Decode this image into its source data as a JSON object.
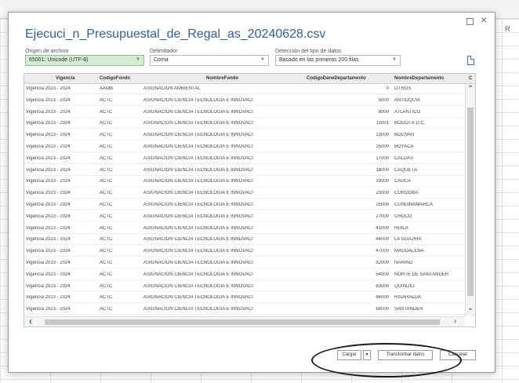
{
  "background": {
    "column_label": "R"
  },
  "dialog": {
    "title": "Ejecuci_n_Presupuestal_de_Regal_as_20240628.csv",
    "window_controls": {
      "maximize_icon": "maximize-icon",
      "close_glyph": "×"
    },
    "options": {
      "origin": {
        "label": "Origen de archivo",
        "value": "65001: Unicode (UTF-8)"
      },
      "delimiter": {
        "label": "Delimitador",
        "value": "Coma"
      },
      "detection": {
        "label": "Detección del tipo de datos",
        "value": "Basado en las primeras 200 filas"
      }
    },
    "table": {
      "columns": [
        "Vigencia",
        "CodigoFondo",
        "NombreFondo",
        "CodigoDaneDepartamento",
        "NombreDepartamento",
        "C"
      ],
      "rows": [
        [
          "Vigencia 2023 - 2024",
          "AAMB",
          "ASIGNACIÓN AMBIENTAL",
          "0",
          "OTROS"
        ],
        [
          "Vigencia 2023 - 2024",
          "ACTC",
          "ASIGNACION CIENCIA TECNOLOGIA E INNOVACION CO...",
          "5000",
          "ANTIOQUIA"
        ],
        [
          "Vigencia 2023 - 2024",
          "ACTC",
          "ASIGNACION CIENCIA TECNOLOGIA E INNOVACION CO...",
          "8000",
          "ATLÁNTICO"
        ],
        [
          "Vigencia 2023 - 2024",
          "ACTC",
          "ASIGNACION CIENCIA TECNOLOGIA E INNOVACION CO...",
          "11001",
          "BOGOTÁ D.C."
        ],
        [
          "Vigencia 2023 - 2024",
          "ACTC",
          "ASIGNACION CIENCIA TECNOLOGIA E INNOVACION CO...",
          "13000",
          "BOLÍVAR"
        ],
        [
          "Vigencia 2023 - 2024",
          "ACTC",
          "ASIGNACION CIENCIA TECNOLOGIA E INNOVACION CO...",
          "15000",
          "BOYACÁ"
        ],
        [
          "Vigencia 2023 - 2024",
          "ACTC",
          "ASIGNACION CIENCIA TECNOLOGIA E INNOVACION CO...",
          "17000",
          "CALDAS"
        ],
        [
          "Vigencia 2023 - 2024",
          "ACTC",
          "ASIGNACION CIENCIA TECNOLOGIA E INNOVACION CO...",
          "18000",
          "CAQUETÁ"
        ],
        [
          "Vigencia 2023 - 2024",
          "ACTC",
          "ASIGNACION CIENCIA TECNOLOGIA E INNOVACION CO...",
          "19000",
          "CAUCA"
        ],
        [
          "Vigencia 2023 - 2024",
          "ACTC",
          "ASIGNACION CIENCIA TECNOLOGIA E INNOVACION CO...",
          "23000",
          "CÓRDOBA"
        ],
        [
          "Vigencia 2023 - 2024",
          "ACTC",
          "ASIGNACION CIENCIA TECNOLOGIA E INNOVACION CO...",
          "25000",
          "CUNDINAMARCA"
        ],
        [
          "Vigencia 2023 - 2024",
          "ACTC",
          "ASIGNACION CIENCIA TECNOLOGIA E INNOVACION CO...",
          "27000",
          "CHOCÓ"
        ],
        [
          "Vigencia 2023 - 2024",
          "ACTC",
          "ASIGNACION CIENCIA TECNOLOGIA E INNOVACION CO...",
          "41000",
          "HUILA"
        ],
        [
          "Vigencia 2023 - 2024",
          "ACTC",
          "ASIGNACION CIENCIA TECNOLOGIA E INNOVACION CO...",
          "44000",
          "LA GUAJIRA"
        ],
        [
          "Vigencia 2023 - 2024",
          "ACTC",
          "ASIGNACION CIENCIA TECNOLOGIA E INNOVACION CO...",
          "47000",
          "MAGDALENA"
        ],
        [
          "Vigencia 2023 - 2024",
          "ACTC",
          "ASIGNACION CIENCIA TECNOLOGIA E INNOVACION CO...",
          "52000",
          "NARIÑO"
        ],
        [
          "Vigencia 2023 - 2024",
          "ACTC",
          "ASIGNACION CIENCIA TECNOLOGIA E INNOVACION CO...",
          "54000",
          "NORTE DE SANTANDER"
        ],
        [
          "Vigencia 2023 - 2024",
          "ACTC",
          "ASIGNACION CIENCIA TECNOLOGIA E INNOVACION CO...",
          "63000",
          "QUINDÍO"
        ],
        [
          "Vigencia 2023 - 2024",
          "ACTC",
          "ASIGNACION CIENCIA TECNOLOGIA E INNOVACION CO...",
          "66000",
          "RISARALDA"
        ],
        [
          "Vigencia 2023 - 2024",
          "ACTC",
          "ASIGNACION CIENCIA TECNOLOGIA E INNOVACION CO...",
          "68000",
          "SANTANDER"
        ]
      ]
    },
    "buttons": {
      "load": "Cargar",
      "load_dropdown": "▾",
      "transform": "Transformar datos",
      "cancel": "Cancelar"
    }
  },
  "colors": {
    "title": "#2f5fa3",
    "origin_highlight": "#d3ecd2",
    "annotation": "#1a1a1a"
  }
}
